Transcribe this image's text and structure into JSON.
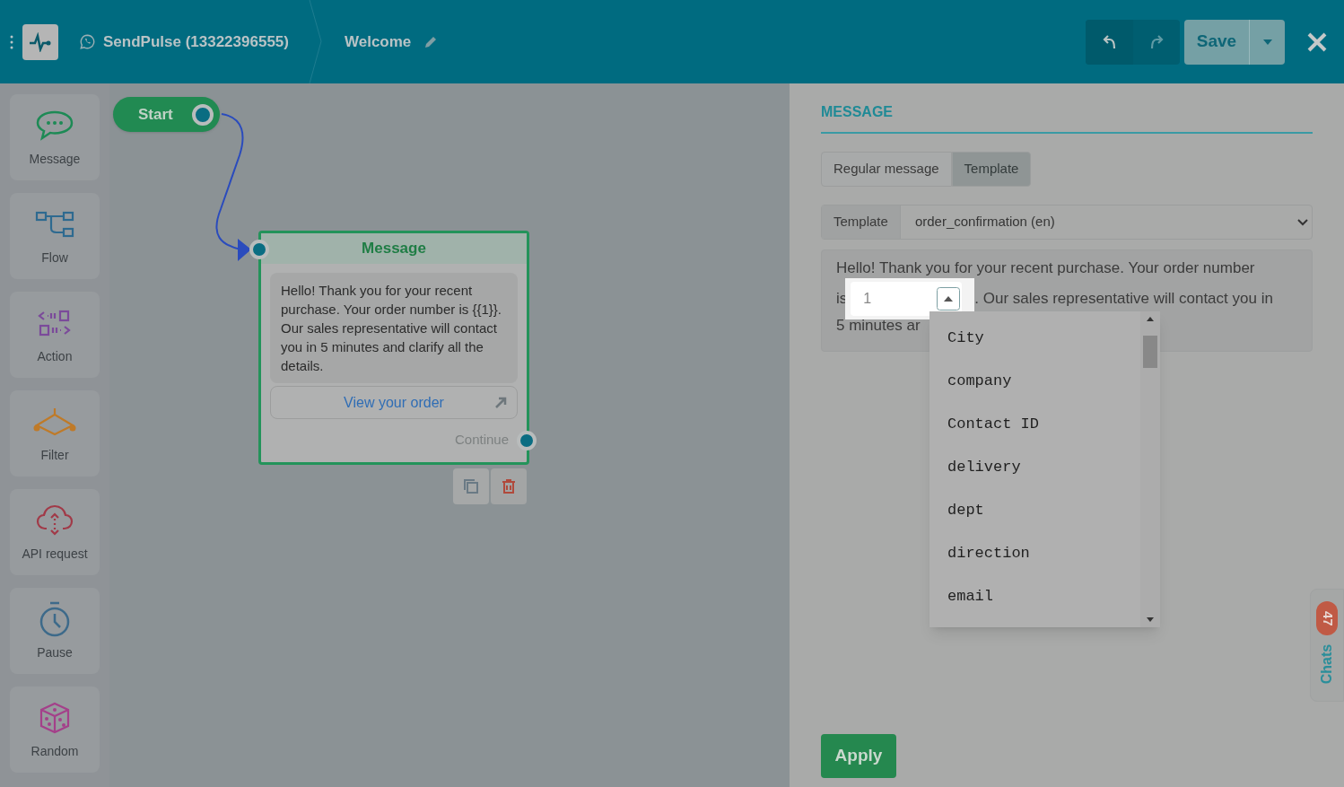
{
  "header": {
    "channel": "SendPulse (13322396555)",
    "flow_title": "Welcome",
    "save": "Save"
  },
  "sidebar": {
    "items": [
      {
        "kind": "message",
        "label": "Message"
      },
      {
        "kind": "flow",
        "label": "Flow"
      },
      {
        "kind": "action",
        "label": "Action"
      },
      {
        "kind": "filter",
        "label": "Filter"
      },
      {
        "kind": "api",
        "label": "API request"
      },
      {
        "kind": "pause",
        "label": "Pause"
      },
      {
        "kind": "random",
        "label": "Random"
      }
    ]
  },
  "canvas": {
    "start_node": {
      "label": "Start"
    },
    "message_node": {
      "title": "Message",
      "text": "Hello! Thank you for your recent purchase. Your order number is {{1}}. Our sales representative will contact you in 5 minutes and clarify all the details.",
      "button": "View your order",
      "output": "Continue"
    }
  },
  "panel": {
    "title": "MESSAGE",
    "tabs": [
      {
        "label": "Regular message",
        "selected": false
      },
      {
        "label": "Template",
        "selected": true
      }
    ],
    "template": {
      "label": "Template",
      "value": "order_confirmation (en)"
    },
    "text": {
      "line_1": "Hello! Thank you for your recent purchase. Your order number",
      "line_2_before": "is",
      "variable": {
        "value": "1"
      },
      "line_2_after": ". Our sales representative will contact you in",
      "line_3": "5 minutes ar"
    },
    "dropdown": {
      "options": [
        {
          "label": "City"
        },
        {
          "label": "company"
        },
        {
          "label": "Contact ID"
        },
        {
          "label": "delivery"
        },
        {
          "label": "dept"
        },
        {
          "label": "direction"
        },
        {
          "label": "email"
        }
      ]
    },
    "apply": "Apply",
    "chats": {
      "label": "Chats",
      "count": "47"
    }
  }
}
